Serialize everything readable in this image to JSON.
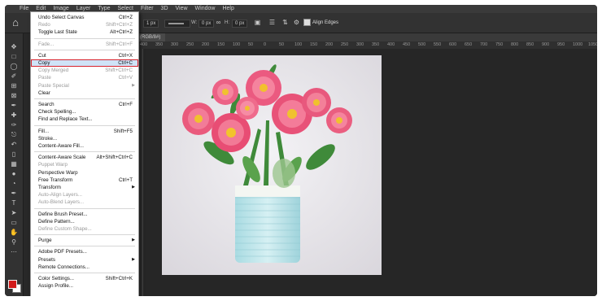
{
  "menubar": [
    "File",
    "Edit",
    "Image",
    "Layer",
    "Type",
    "Select",
    "Filter",
    "3D",
    "View",
    "Window",
    "Help"
  ],
  "options": {
    "size": "1 px",
    "w_label": "W:",
    "w_value": "0 px",
    "h_label": "H:",
    "h_value": "0 px",
    "align_edges_label": "Align Edges",
    "align_edges_checked": true
  },
  "document_tab": "(RGB/8#)",
  "ruler_ticks": [
    "400",
    "350",
    "300",
    "250",
    "200",
    "150",
    "100",
    "50",
    "0",
    "50",
    "100",
    "150",
    "200",
    "250",
    "300",
    "350",
    "400",
    "450",
    "500",
    "550",
    "600",
    "650",
    "700",
    "750",
    "800",
    "850",
    "900",
    "950",
    "1000",
    "1050"
  ],
  "colors": {
    "foreground": "#d11a1a",
    "background": "#ffffff",
    "highlight_outline": "#d6232e"
  },
  "edit_menu": {
    "items": [
      {
        "label": "Undo Select Canvas",
        "shortcut": "Ctrl+Z",
        "disabled": false
      },
      {
        "label": "Redo",
        "shortcut": "Shift+Ctrl+Z",
        "disabled": true
      },
      {
        "label": "Toggle Last State",
        "shortcut": "Alt+Ctrl+Z",
        "disabled": false
      },
      {
        "label": "Fade...",
        "shortcut": "Shift+Ctrl+F",
        "disabled": true
      },
      {
        "label": "Cut",
        "shortcut": "Ctrl+X",
        "disabled": false
      },
      {
        "label": "Copy",
        "shortcut": "Ctrl+C",
        "disabled": false,
        "highlighted": true
      },
      {
        "label": "Copy Merged",
        "shortcut": "Shift+Ctrl+C",
        "disabled": true
      },
      {
        "label": "Paste",
        "shortcut": "Ctrl+V",
        "disabled": true
      },
      {
        "label": "Paste Special",
        "shortcut": "",
        "disabled": true
      },
      {
        "label": "Clear",
        "shortcut": "",
        "disabled": false
      },
      {
        "label": "Search",
        "shortcut": "Ctrl+F",
        "disabled": false
      },
      {
        "label": "Check Spelling...",
        "shortcut": "",
        "disabled": false
      },
      {
        "label": "Find and Replace Text...",
        "shortcut": "",
        "disabled": false
      },
      {
        "label": "Fill...",
        "shortcut": "Shift+F5",
        "disabled": false
      },
      {
        "label": "Stroke...",
        "shortcut": "",
        "disabled": false
      },
      {
        "label": "Content-Aware Fill...",
        "shortcut": "",
        "disabled": false
      },
      {
        "label": "Content-Aware Scale",
        "shortcut": "Alt+Shift+Ctrl+C",
        "disabled": false
      },
      {
        "label": "Puppet Warp",
        "shortcut": "",
        "disabled": true
      },
      {
        "label": "Perspective Warp",
        "shortcut": "",
        "disabled": false
      },
      {
        "label": "Free Transform",
        "shortcut": "Ctrl+T",
        "disabled": false
      },
      {
        "label": "Transform",
        "shortcut": "",
        "disabled": false
      },
      {
        "label": "Auto-Align Layers...",
        "shortcut": "",
        "disabled": true
      },
      {
        "label": "Auto-Blend Layers...",
        "shortcut": "",
        "disabled": true
      },
      {
        "label": "Define Brush Preset...",
        "shortcut": "",
        "disabled": false
      },
      {
        "label": "Define Pattern...",
        "shortcut": "",
        "disabled": false
      },
      {
        "label": "Define Custom Shape...",
        "shortcut": "",
        "disabled": true
      },
      {
        "label": "Purge",
        "shortcut": "",
        "disabled": false
      },
      {
        "label": "Adobe PDF Presets...",
        "shortcut": "",
        "disabled": false
      },
      {
        "label": "Presets",
        "shortcut": "",
        "disabled": false
      },
      {
        "label": "Remote Connections...",
        "shortcut": "",
        "disabled": false
      },
      {
        "label": "Color Settings...",
        "shortcut": "Shift+Ctrl+K",
        "disabled": false
      },
      {
        "label": "Assign Profile...",
        "shortcut": "",
        "disabled": false
      }
    ]
  },
  "tool_icons": [
    "move-icon",
    "marquee-icon",
    "lasso-icon",
    "quick-select-icon",
    "crop-icon",
    "frame-icon",
    "eyedropper-icon",
    "healing-icon",
    "brush-icon",
    "stamp-icon",
    "history-brush-icon",
    "eraser-icon",
    "gradient-icon",
    "blur-icon",
    "dodge-icon",
    "pen-icon",
    "type-icon",
    "path-select-icon",
    "rectangle-icon",
    "hand-icon",
    "zoom-icon"
  ]
}
